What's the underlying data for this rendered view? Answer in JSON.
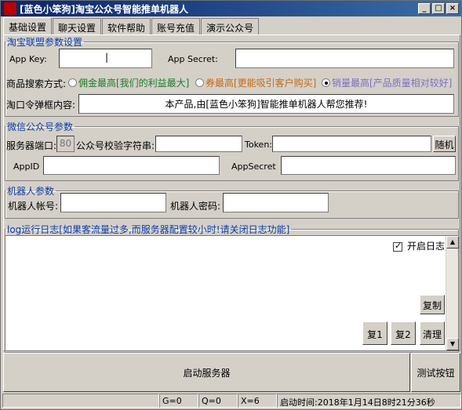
{
  "window": {
    "title": "[蓝色小笨狗]淘宝公众号智能推单机器人",
    "buttons": [
      "_",
      "□",
      "×"
    ]
  },
  "tabs": [
    {
      "label": "基础设置",
      "active": true
    },
    {
      "label": "聊天设置",
      "active": false
    },
    {
      "label": "软件帮助",
      "active": false
    },
    {
      "label": "账号充值",
      "active": false
    },
    {
      "label": "演示公众号",
      "active": false
    }
  ],
  "taobao": {
    "legend": "淘宝联盟参数设置",
    "app_key_label": "App Key:",
    "app_key_value": "|",
    "app_secret_label": "App Secret:",
    "app_secret_value": "",
    "search_mode_label": "商品搜索方式:",
    "options": [
      {
        "label": "佣金最高[我们的利益最大]",
        "color": "#1c7c24",
        "checked": false
      },
      {
        "label": "券最高[更能吸引客户购买]",
        "color": "#c46a13",
        "checked": false
      },
      {
        "label": "销量最高[产品质量相对较好]",
        "color": "#7b6fc0",
        "checked": true
      }
    ],
    "popup_label": "淘口令弹框内容:",
    "popup_value": "本产品,由[蓝色小笨狗]智能推单机器人帮您推荐!"
  },
  "wechat": {
    "legend": "微信公众号参数",
    "port_label": "服务器端口:",
    "port_value": "80",
    "verify_label": "公众号校验字符串:",
    "verify_value": "",
    "token_label": "Token:",
    "token_value": "",
    "random_button": "随机",
    "appid_label": "AppID",
    "appid_value": "",
    "appsecret_label": "AppSecret",
    "appsecret_value": ""
  },
  "robot": {
    "legend": "机器人参数",
    "account_label": "机器人帐号:",
    "account_value": "",
    "password_label": "机器人密码:",
    "password_value": ""
  },
  "log": {
    "legend": "log运行日志[如果客流量过多,而服务器配置较小时!请关闭日志功能]",
    "enable_label": "开启日志",
    "enabled": true,
    "copy_button": "复制",
    "copy1_button": "复1",
    "copy2_button": "复2",
    "clear_button": "清理"
  },
  "actions": {
    "start_button": "启动服务器",
    "test_button": "测试按钮"
  },
  "status": {
    "seg1": "",
    "g": "G=0",
    "q": "Q=0",
    "x": "X=6",
    "start_time": "启动时间:2018年1月14日8时21分36秒"
  }
}
